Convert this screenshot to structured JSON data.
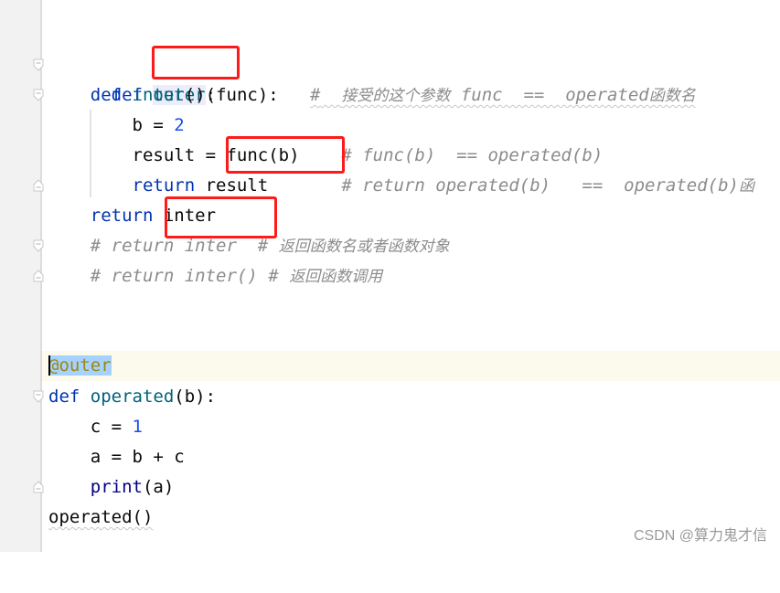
{
  "editor": {
    "language": "python",
    "lines": {
      "l1": {
        "def": "def",
        "name": "outer",
        "params": "(func):",
        "comment_hash": "#",
        "comment_cjk1": "接受的这个参数",
        "comment_code": " func  ==  operated",
        "comment_cjk2": "函数名"
      },
      "l2": {
        "def": "def",
        "name": "inter",
        "params": "():"
      },
      "l3": {
        "var": "b",
        "op": " = ",
        "num": "2"
      },
      "l4": {
        "var": "result",
        "op": " = ",
        "call": "func(b)",
        "comment": "# func(b)  == operated(b)"
      },
      "l5": {
        "kw": "return",
        "rest": " result",
        "comment": "# return operated(b)   ==  operated(b)",
        "comment_cjk": "函"
      },
      "l6": {
        "kw": "return",
        "rest": " inter"
      },
      "l7": {
        "comment_code": "# return inter  # ",
        "comment_cjk": "返回函数名或者函数对象"
      },
      "l8": {
        "comment_code": "# return inter() # ",
        "comment_cjk": "返回函数调用"
      },
      "l9": {
        "decorator": "@outer"
      },
      "l10": {
        "def": "def",
        "name": "operated",
        "params": "(b):"
      },
      "l11": {
        "var": "c",
        "op": " = ",
        "num": "1"
      },
      "l12": {
        "expr": "a = b + c"
      },
      "l13": {
        "builtin": "print",
        "args": "(a)"
      },
      "l14": {
        "call": "operated()"
      }
    }
  },
  "annotations": {
    "color": "#ff1a1a",
    "boxes": [
      "func parameter",
      "func(b) call",
      "return inter"
    ]
  },
  "watermark": "CSDN @算力鬼才信"
}
